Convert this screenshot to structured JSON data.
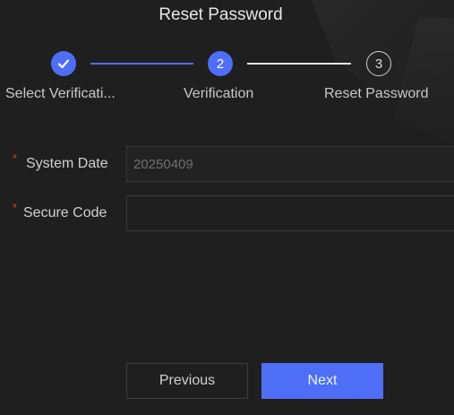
{
  "dialog": {
    "title": "Reset Password"
  },
  "steps": [
    {
      "number": "1",
      "label": "Select Verificati...",
      "state": "done",
      "icon": "check-icon"
    },
    {
      "number": "2",
      "label": "Verification",
      "state": "active"
    },
    {
      "number": "3",
      "label": "Reset Password",
      "state": "pending"
    }
  ],
  "form": {
    "system_date": {
      "label": "System Date",
      "value": "20250409",
      "required_mark": "*"
    },
    "secure_code": {
      "label": "Secure Code",
      "value": "",
      "required_mark": "*"
    }
  },
  "buttons": {
    "previous": "Previous",
    "next": "Next"
  },
  "colors": {
    "accent": "#4f6ef7",
    "background": "#1f1f1f",
    "required": "#e53935"
  }
}
